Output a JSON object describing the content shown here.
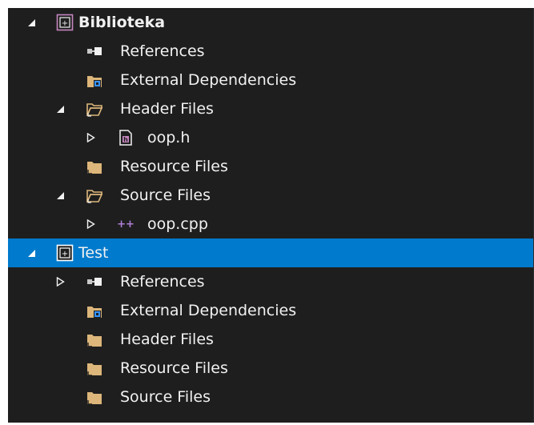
{
  "solution_explorer": {
    "projects": [
      {
        "name": "Biblioteka",
        "expanded": true,
        "selected": false,
        "children": [
          {
            "label": "References",
            "icon": "references-icon",
            "expander": "none"
          },
          {
            "label": "External Dependencies",
            "icon": "external-dependencies-icon",
            "expander": "none"
          },
          {
            "label": "Header Files",
            "icon": "folder-filter-icon",
            "expander": "expanded",
            "children": [
              {
                "label": "oop.h",
                "icon": "header-file-icon",
                "expander": "collapsed"
              }
            ]
          },
          {
            "label": "Resource Files",
            "icon": "folder-filter-icon",
            "expander": "none"
          },
          {
            "label": "Source Files",
            "icon": "folder-filter-icon",
            "expander": "expanded",
            "children": [
              {
                "label": "oop.cpp",
                "icon": "cpp-file-icon",
                "expander": "collapsed"
              }
            ]
          }
        ]
      },
      {
        "name": "Test",
        "expanded": true,
        "selected": true,
        "children": [
          {
            "label": "References",
            "icon": "references-icon",
            "expander": "collapsed"
          },
          {
            "label": "External Dependencies",
            "icon": "external-dependencies-icon",
            "expander": "none"
          },
          {
            "label": "Header Files",
            "icon": "folder-filter-icon",
            "expander": "none"
          },
          {
            "label": "Resource Files",
            "icon": "folder-filter-icon",
            "expander": "none"
          },
          {
            "label": "Source Files",
            "icon": "folder-filter-icon",
            "expander": "none"
          }
        ]
      }
    ]
  },
  "colors": {
    "background": "#1e1e1e",
    "selection": "#007acc",
    "text": "#f1f1f1",
    "folder": "#dcb67a",
    "project_icon": "#c586c0",
    "cpp_icon": "#b180d7"
  }
}
